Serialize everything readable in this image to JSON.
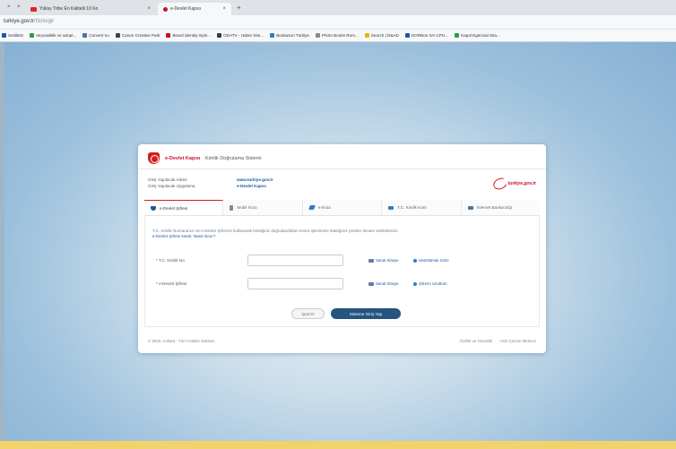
{
  "browser": {
    "tabs": [
      {
        "label": "Yüksy Tribe En Kalitelli 10 Ko"
      },
      {
        "label": "e-Devlet Kapısı"
      }
    ],
    "url_host": "turkiye.gov.tr",
    "url_path": "/Giris/gir",
    "bookmarks": [
      {
        "label": "Sesliköz",
        "color": "#1f56a5"
      },
      {
        "label": "Veyvasiklik ve adopt...",
        "color": "#2d9c4b"
      },
      {
        "label": "Convert nu",
        "color": "#4b6fa8"
      },
      {
        "label": "Canon Creative Park",
        "color": "#444444"
      },
      {
        "label": "Brand identity style...",
        "color": "#c8102e"
      },
      {
        "label": "ODATV - Haber Site...",
        "color": "#2c3e50"
      },
      {
        "label": "Bookasori Türkiye",
        "color": "#3a78c3"
      },
      {
        "label": "Photo Books Rom...",
        "color": "#888888"
      },
      {
        "label": "Search | D&AD",
        "color": "#e6b800"
      },
      {
        "label": "DORBoo IVA CPU...",
        "color": "#1f56a5"
      },
      {
        "label": "Kapal Egencial Sita...",
        "color": "#2d9c4b"
      }
    ]
  },
  "header": {
    "brand": "e-Devlet Kapısı",
    "subtitle": "Kimlik Doğrulama Sistemi"
  },
  "app_info": {
    "name_label": "Giriş Yapılacak Adres",
    "name_value": "www.turkiye.gov.tr",
    "app_label": "Giriş Yapılacak Uygulama",
    "app_value": "e-Devlet Kapısı"
  },
  "logo": {
    "text": "turkiye.gov.tr"
  },
  "auth_tabs": [
    {
      "label": "e-Devlet Şifresi",
      "icon": "key-icon"
    },
    {
      "label": "Mobil İmza",
      "icon": "phone-icon"
    },
    {
      "label": "e-İmza",
      "icon": "pen-icon"
    },
    {
      "label": "T.C. Kimlik Kartı",
      "icon": "id-card-icon"
    },
    {
      "label": "İnternet Bankacılığı",
      "icon": "bank-icon"
    }
  ],
  "form": {
    "intro": "T.C. Kimlik Numaranızı ve e-Devlet Şifrenizi kullanarak kimliğiniz doğrulandıktan sonra işleminize kaldığınız yerden devam edebilirsiniz.",
    "intro_link": "e-Devlet Şifresi Nedir, Nasıl Alınır?",
    "tc_label": "* T.C. Kimlik No",
    "tc_value": "",
    "pwd_label": "* e-Devlet Şifresi",
    "pwd_value": "",
    "virtual_kbd_1": "Sanal Klavye",
    "remember": "Hatırlatmak Gizle",
    "virtual_kbd_2": "Sanal Klavye",
    "forgot": "Şifremi Unuttum",
    "cancel": "İptal Et",
    "login": "Sisteme Giriş Yap"
  },
  "footer": {
    "copyright": "© 2015, Ankara · Tüm Hakları Saklıdır.",
    "privacy": "Gizlilik ve Güvenlik",
    "help": "Hızlı Çözüm Merkezi"
  }
}
